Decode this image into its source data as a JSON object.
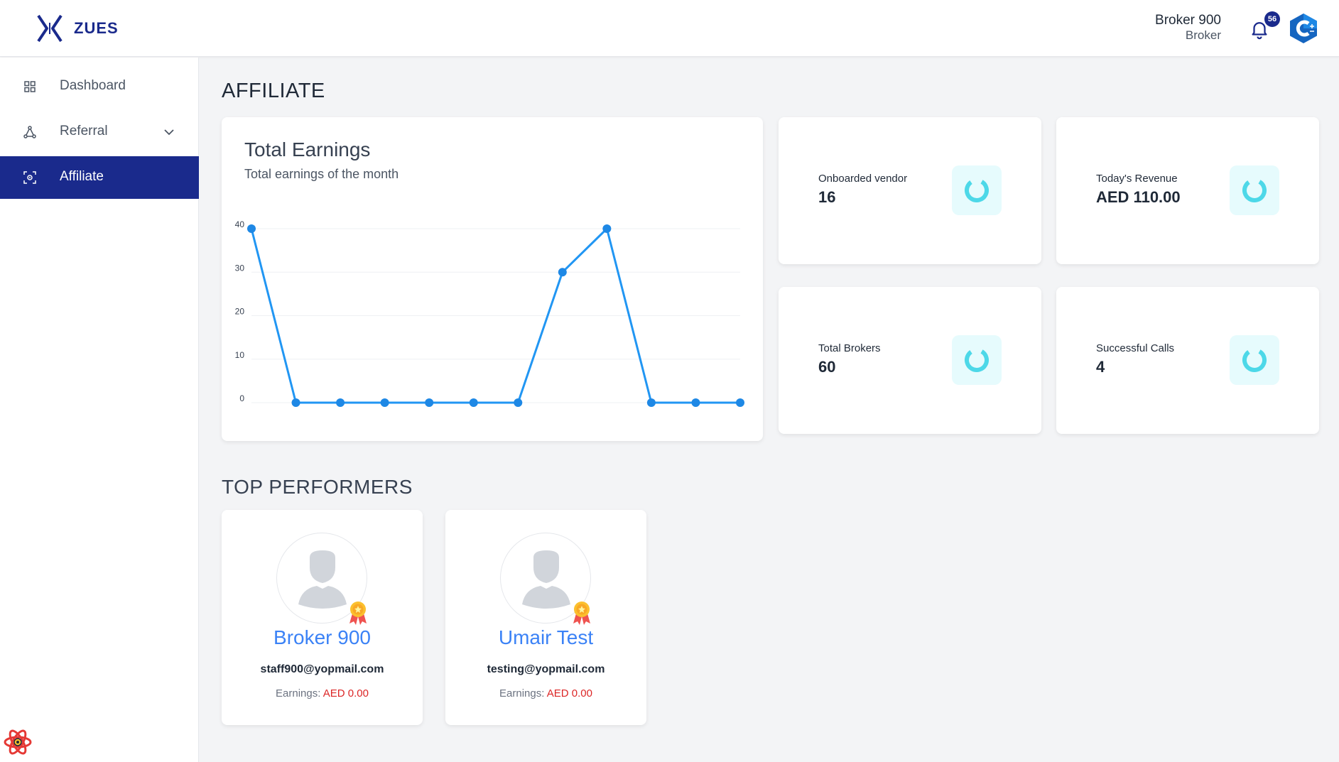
{
  "app": {
    "brand_name": "ZUES"
  },
  "header": {
    "user_name": "Broker 900",
    "user_role": "Broker",
    "notification_count": "56"
  },
  "sidebar": {
    "items": [
      {
        "label": "Dashboard",
        "icon": "grid-icon"
      },
      {
        "label": "Referral",
        "icon": "network-icon",
        "has_submenu": true
      },
      {
        "label": "Affiliate",
        "icon": "affiliate-icon",
        "active": true
      }
    ]
  },
  "page": {
    "title": "AFFILIATE"
  },
  "earnings": {
    "title": "Total Earnings",
    "subtitle": "Total earnings of the month"
  },
  "chart_data": {
    "type": "line",
    "title": "Total Earnings",
    "subtitle": "Total earnings of the month",
    "values": [
      40,
      0,
      0,
      0,
      0,
      0,
      0,
      30,
      40,
      0,
      0,
      0
    ],
    "y_ticks": [
      0,
      10,
      20,
      30,
      40
    ],
    "ylim": [
      0,
      40
    ],
    "grid": true,
    "color": "#2196f3"
  },
  "stats": [
    {
      "label": "Onboarded vendor",
      "value": "16"
    },
    {
      "label": "Today's Revenue",
      "value": "AED 110.00"
    },
    {
      "label": "Total Brokers",
      "value": "60"
    },
    {
      "label": "Successful Calls",
      "value": "4"
    }
  ],
  "top_performers": {
    "title": "TOP PERFORMERS",
    "items": [
      {
        "name": "Broker 900",
        "email": "staff900@yopmail.com",
        "earnings_label": "Earnings:",
        "earnings_value": "AED 0.00"
      },
      {
        "name": "Umair Test",
        "email": "testing@yopmail.com",
        "earnings_label": "Earnings:",
        "earnings_value": "AED 0.00"
      }
    ]
  },
  "colors": {
    "brand": "#1a2a8c",
    "accent": "#3b82f6",
    "stat_icon": "#4dd8e8",
    "earnings_amount": "#dc2626"
  }
}
